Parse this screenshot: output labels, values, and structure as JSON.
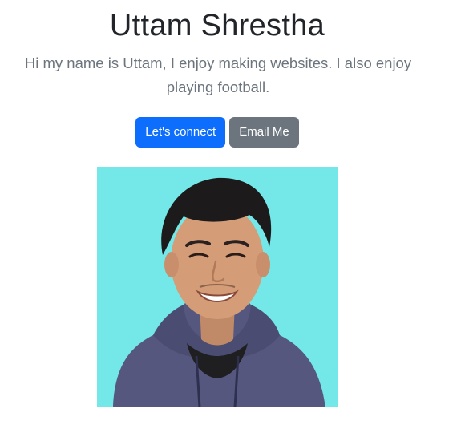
{
  "header": {
    "title": "Uttam Shrestha",
    "intro": "Hi my name is Uttam, I enjoy making websites. I also enjoy playing football."
  },
  "actions": {
    "connect_label": "Let's connect",
    "email_label": "Email Me"
  },
  "colors": {
    "primary": "#0d6efd",
    "secondary": "#6c757d",
    "photo_background": "#74e8e8",
    "hoodie": "#55577e"
  },
  "icons": {
    "portrait": "profile-photo"
  }
}
